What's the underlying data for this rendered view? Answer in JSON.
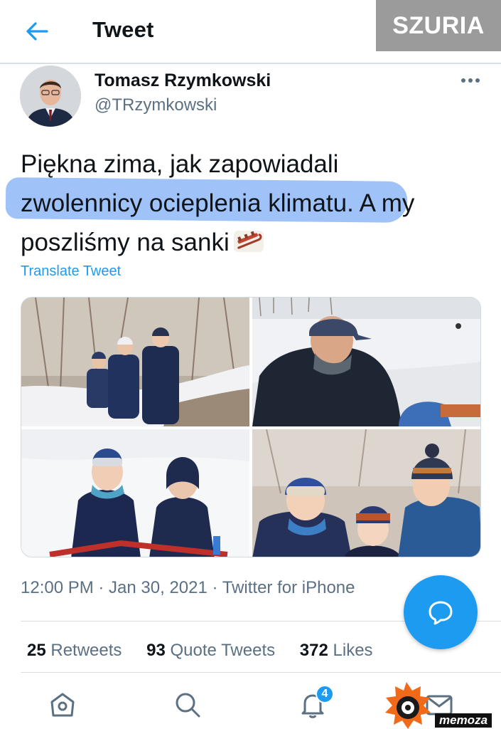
{
  "header": {
    "title": "Tweet",
    "back_icon": "arrow-left-icon"
  },
  "watermark": {
    "label": "SZURIA"
  },
  "author": {
    "name": "Tomasz Rzymkowski",
    "handle": "@TRzymkowski"
  },
  "tweet": {
    "line1": "Piękna zima, jak zapowiadali",
    "line2_highlight": "zwolennicy ocieplenia klimatu.",
    "line2_rest": " A my",
    "line3": "poszliśmy na sanki",
    "emoji": "sled-icon",
    "translate_label": "Translate Tweet"
  },
  "meta": {
    "text": "12:00 PM · Jan 30, 2021 · Twitter for iPhone"
  },
  "stats": {
    "retweets_count": "25",
    "retweets_label": "Retweets",
    "quotes_count": "93",
    "quotes_label": "Quote Tweets",
    "likes_count": "372",
    "likes_label": "Likes"
  },
  "nav": {
    "notifications_badge": "4"
  },
  "logo": {
    "label": "memoza"
  },
  "colors": {
    "accent": "#1d9bf0",
    "highlight": "#7aaaf5",
    "secondary_text": "#5b7083"
  }
}
